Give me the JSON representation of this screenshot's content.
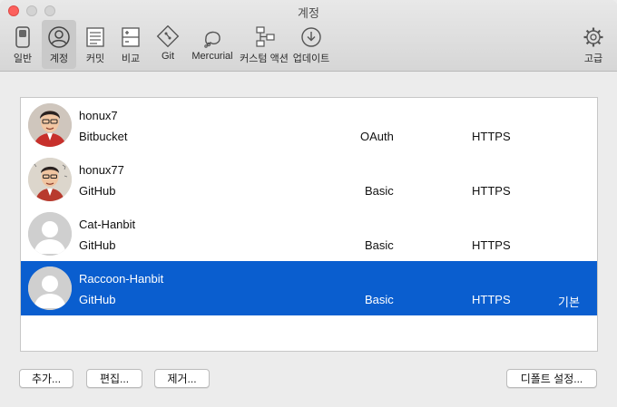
{
  "window": {
    "title": "계정"
  },
  "toolbar": {
    "items": [
      {
        "label": "일반"
      },
      {
        "label": "계정"
      },
      {
        "label": "커밋"
      },
      {
        "label": "비교"
      },
      {
        "label": "Git"
      },
      {
        "label": "Mercurial"
      },
      {
        "label": "커스텀 액션"
      },
      {
        "label": "업데이트"
      },
      {
        "label": "고급"
      }
    ],
    "selected": "계정"
  },
  "accounts": [
    {
      "name": "honux7",
      "host": "Bitbucket",
      "auth": "OAuth",
      "protocol": "HTTPS",
      "default": ""
    },
    {
      "name": "honux77",
      "host": "GitHub",
      "auth": "Basic",
      "protocol": "HTTPS",
      "default": ""
    },
    {
      "name": "Cat-Hanbit",
      "host": "GitHub",
      "auth": "Basic",
      "protocol": "HTTPS",
      "default": ""
    },
    {
      "name": "Raccoon-Hanbit",
      "host": "GitHub",
      "auth": "Basic",
      "protocol": "HTTPS",
      "default": "기본"
    }
  ],
  "selected_account": "Raccoon-Hanbit",
  "buttons": {
    "add": "추가...",
    "edit": "편집...",
    "remove": "제거...",
    "default_settings": "디폴트 설정..."
  },
  "colors": {
    "selection": "#0a5ecf",
    "close": "#fc605c"
  }
}
